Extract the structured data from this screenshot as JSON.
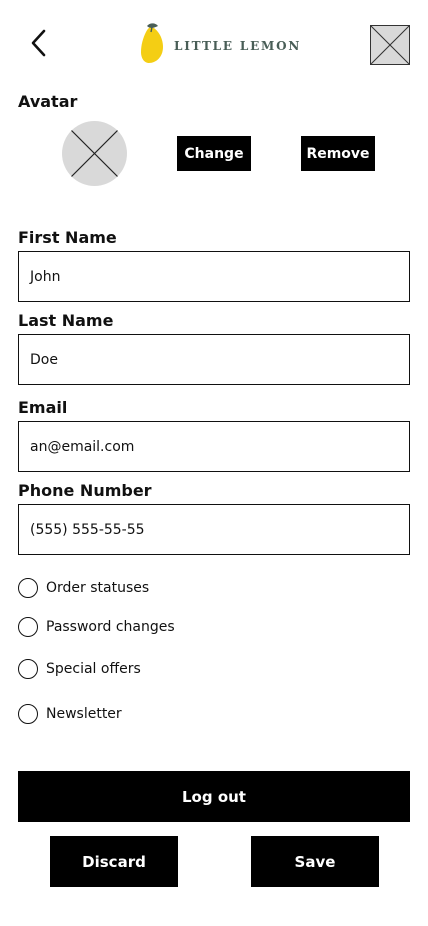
{
  "header": {
    "back_icon": "chevron-left-icon",
    "logo_text": "LITTLE LEMON",
    "logo_icon": "lemon-icon",
    "avatar_placeholder": "image-placeholder-icon"
  },
  "avatar": {
    "label": "Avatar",
    "change_label": "Change",
    "remove_label": "Remove"
  },
  "fields": {
    "first_name": {
      "label": "First Name",
      "value": "John"
    },
    "last_name": {
      "label": "Last Name",
      "value": "Doe"
    },
    "email": {
      "label": "Email",
      "value": "an@email.com"
    },
    "phone": {
      "label": "Phone Number",
      "value": "(555) 555-55-55"
    }
  },
  "notifications": [
    {
      "label": "Order statuses",
      "checked": false
    },
    {
      "label": "Password changes",
      "checked": false
    },
    {
      "label": "Special offers",
      "checked": false
    },
    {
      "label": "Newsletter",
      "checked": false
    }
  ],
  "actions": {
    "logout_label": "Log out",
    "discard_label": "Discard",
    "save_label": "Save"
  },
  "colors": {
    "primary": "#000000",
    "on_primary": "#FFFFFF",
    "placeholder_gray": "#D9D9D9",
    "brand_green": "#495E57",
    "lemon_yellow": "#F4CE14"
  }
}
